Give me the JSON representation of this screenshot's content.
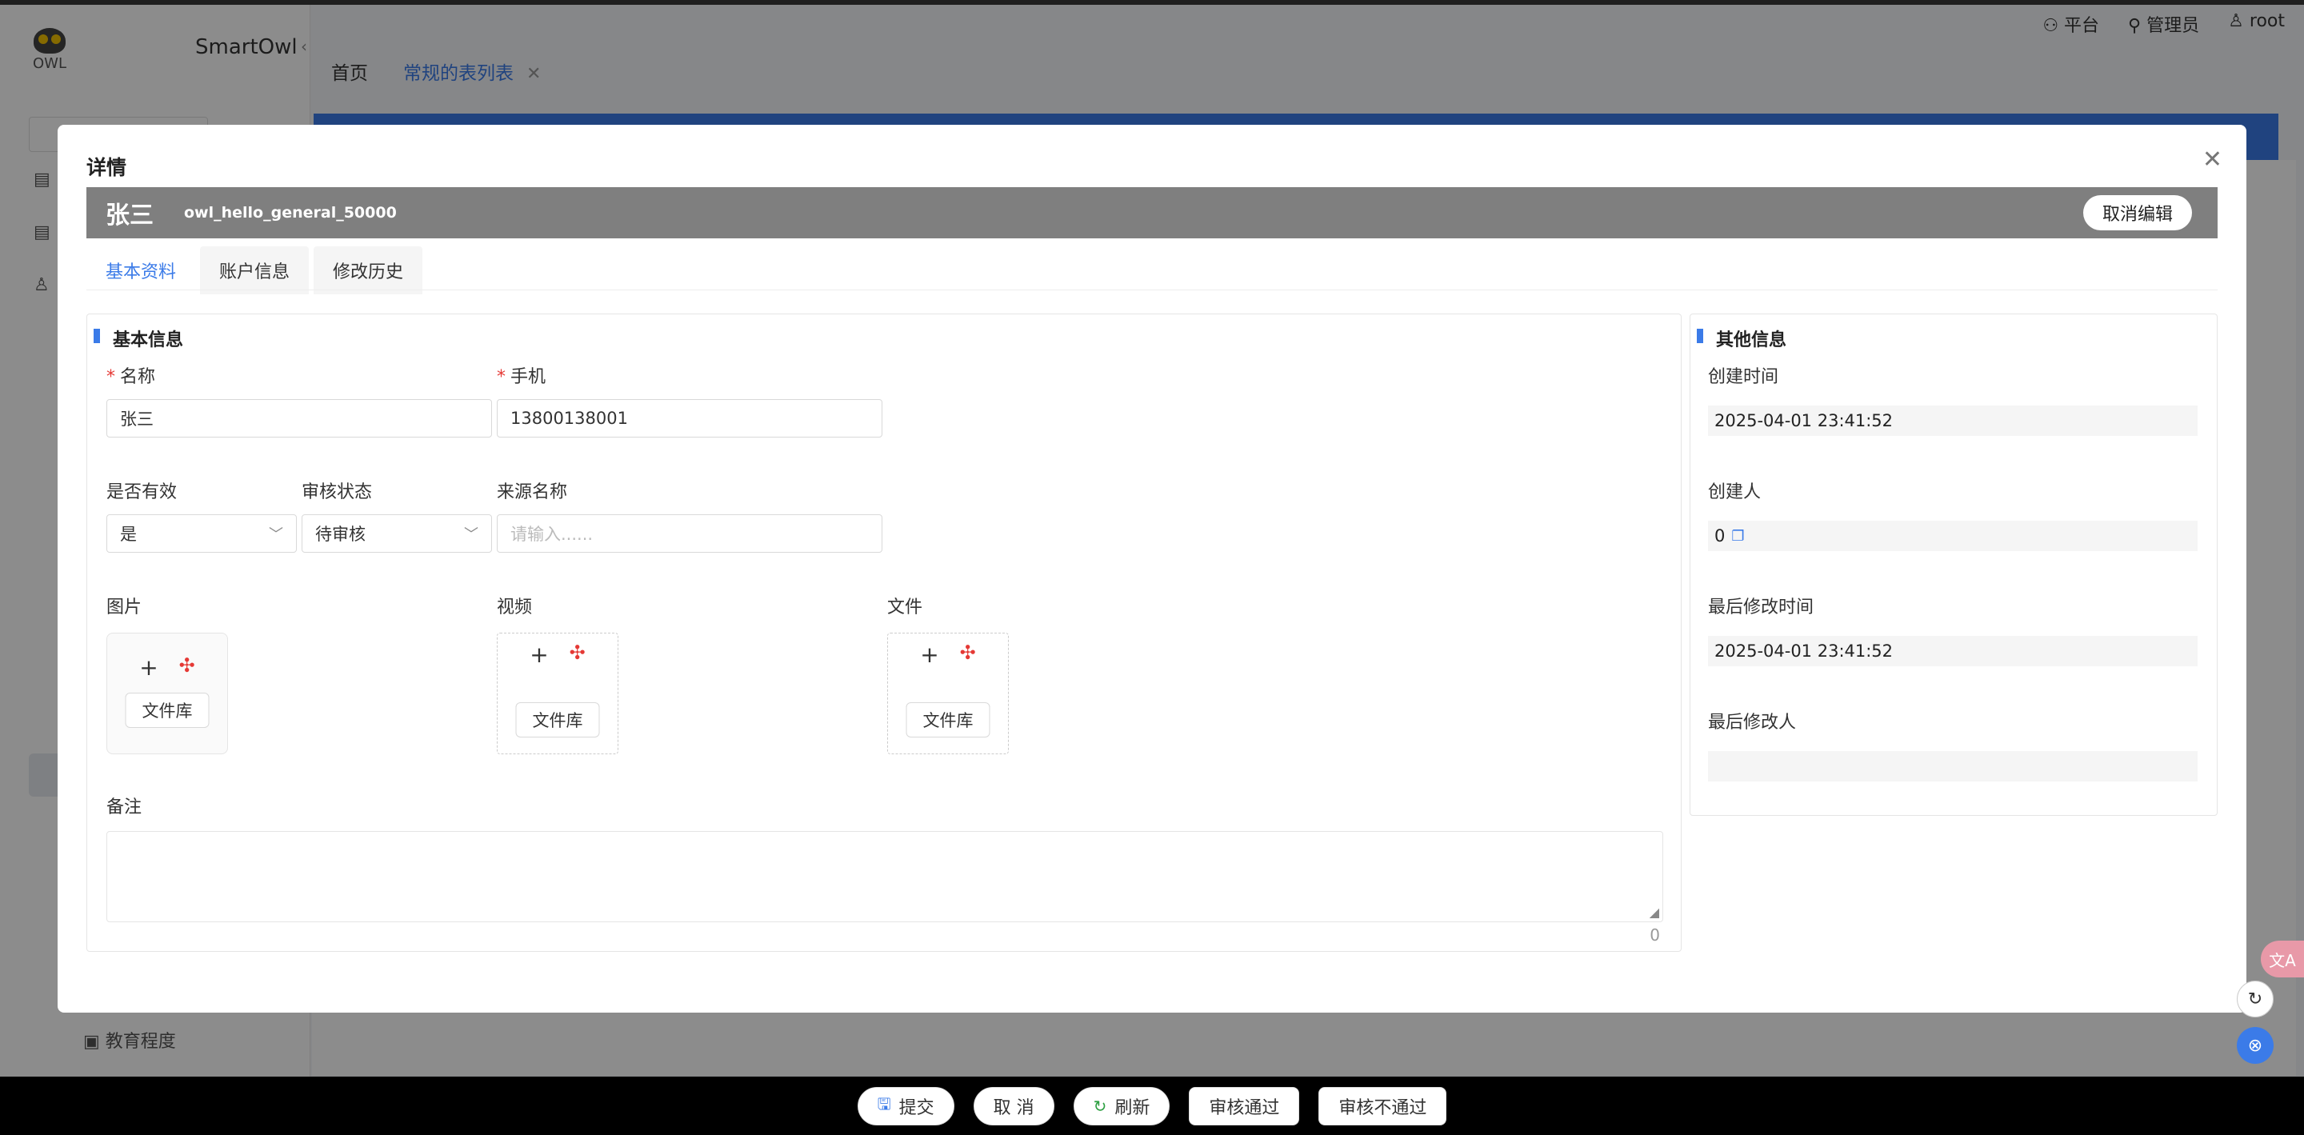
{
  "app": {
    "brand": "SmartOwl",
    "logo_text": "OWL"
  },
  "topbar": {
    "platform": "平台",
    "admin": "管理员",
    "user": "root",
    "tabs": [
      {
        "label": "首页"
      },
      {
        "label": "常规的表列表"
      }
    ]
  },
  "sidebar": {
    "bottom_item": "教育程度"
  },
  "modal": {
    "title": "详情",
    "record_name": "张三",
    "record_code": "owl_hello_general_50000",
    "cancel_edit": "取消编辑",
    "tabs": [
      {
        "label": "基本资料"
      },
      {
        "label": "账户信息"
      },
      {
        "label": "修改历史"
      }
    ],
    "basic": {
      "section_title": "基本信息",
      "name_label": "名称",
      "name_value": "张三",
      "phone_label": "手机",
      "phone_value": "13800138001",
      "valid_label": "是否有效",
      "valid_value": "是",
      "audit_label": "审核状态",
      "audit_value": "待审核",
      "source_label": "来源名称",
      "source_placeholder": "请输入......",
      "image_label": "图片",
      "video_label": "视频",
      "file_label": "文件",
      "library_label": "文件库",
      "remark_label": "备注",
      "remark_count": "0"
    },
    "other": {
      "section_title": "其他信息",
      "created_time_label": "创建时间",
      "created_time": "2025-04-01 23:41:52",
      "creator_label": "创建人",
      "creator": "0",
      "modified_time_label": "最后修改时间",
      "modified_time": "2025-04-01 23:41:52",
      "modifier_label": "最后修改人",
      "modifier": ""
    }
  },
  "bottom_actions": {
    "submit": "提交",
    "cancel": "取 消",
    "refresh": "刷新",
    "approve": "审核通过",
    "reject": "审核不通过"
  },
  "colors": {
    "accent": "#3b7be8",
    "header_gray": "#7f7f7f",
    "required": "#e53935"
  }
}
